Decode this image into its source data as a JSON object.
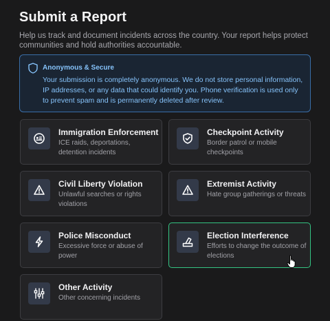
{
  "header": {
    "title": "Submit a Report",
    "intro": "Help us track and document incidents across the country. Your report helps protect communities and hold authorities accountable."
  },
  "notice": {
    "icon": "shield-icon",
    "title": "Anonymous & Secure",
    "text": "Your submission is completely anonymous. We do not store personal information, IP addresses, or any data that could identify you. Phone verification is used only to prevent spam and is permanently deleted after review."
  },
  "categories": [
    {
      "title": "Immigration Enforcement",
      "desc": "ICE raids, deportations, detention incidents",
      "icon": "ice-badge-icon",
      "selected": false
    },
    {
      "title": "Checkpoint Activity",
      "desc": "Border patrol or mobile checkpoints",
      "icon": "shield-check-icon",
      "selected": false
    },
    {
      "title": "Civil Liberty Violation",
      "desc": "Unlawful searches or rights violations",
      "icon": "warning-triangle-icon",
      "selected": false
    },
    {
      "title": "Extremist Activity",
      "desc": "Hate group gatherings or threats",
      "icon": "warning-triangle-icon",
      "selected": false
    },
    {
      "title": "Police Misconduct",
      "desc": "Excessive force or abuse of power",
      "icon": "lightning-icon",
      "selected": false
    },
    {
      "title": "Election Interference",
      "desc": "Efforts to change the outcome of elections",
      "icon": "ballot-box-icon",
      "selected": true
    },
    {
      "title": "Other Activity",
      "desc": "Other concerning incidents",
      "icon": "sliders-icon",
      "selected": false
    }
  ],
  "colors": {
    "accent_selected": "#34c583",
    "notice_text": "#86c3fb",
    "notice_border": "#3a6ea8"
  }
}
